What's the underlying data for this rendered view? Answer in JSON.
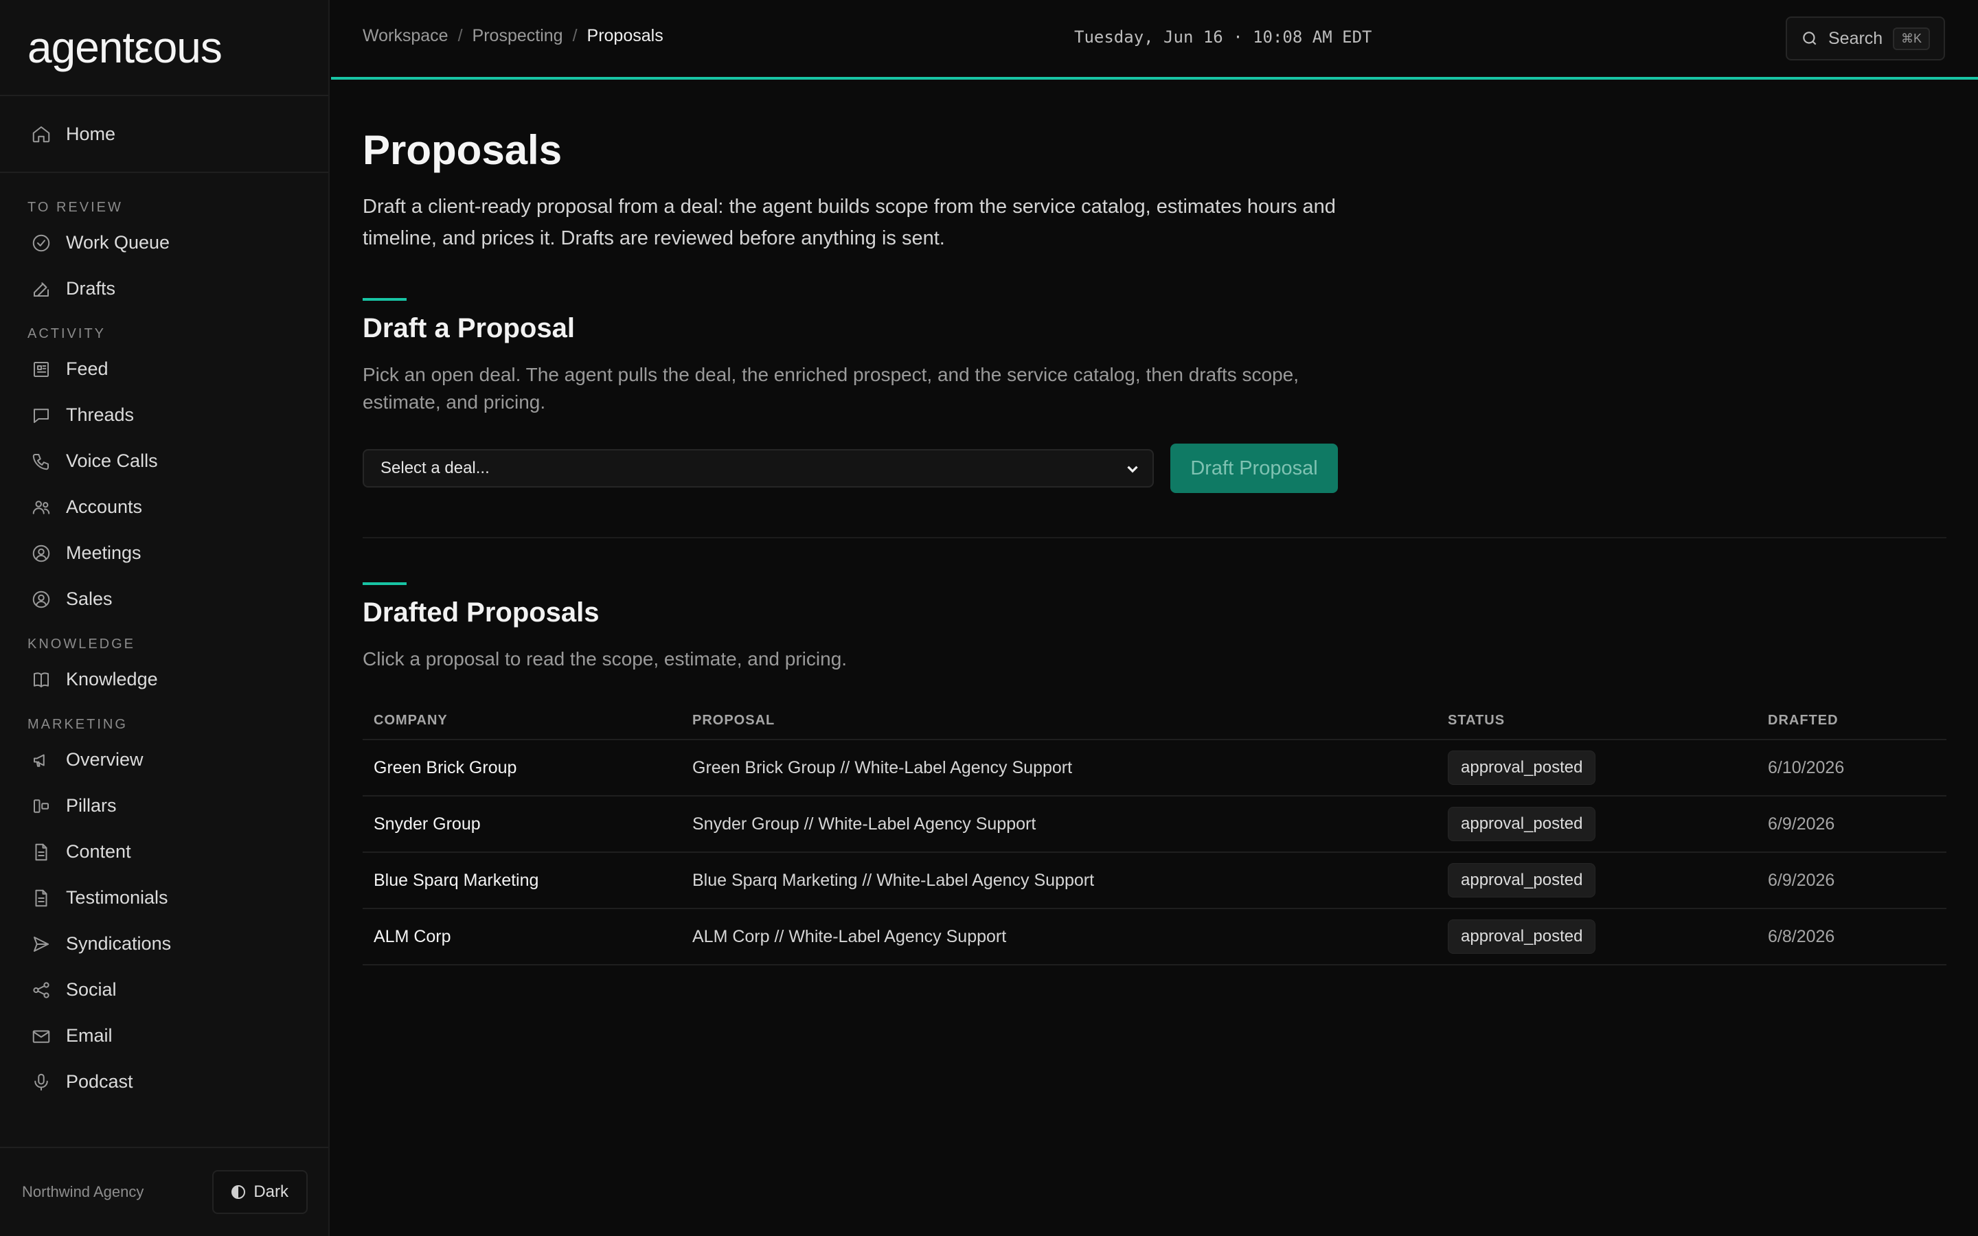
{
  "app": {
    "logo": "agentεous",
    "agency": "Northwind Agency",
    "theme_label": "Dark"
  },
  "header": {
    "breadcrumb": [
      "Workspace",
      "Prospecting",
      "Proposals"
    ],
    "datetime": "Tuesday, Jun 16 · 10:08 AM EDT",
    "search_label": "Search",
    "search_shortcut": "⌘K"
  },
  "sidebar": {
    "home": {
      "label": "Home",
      "icon": "home-icon"
    },
    "sections": [
      {
        "label": "TO REVIEW",
        "items": [
          {
            "label": "Work Queue",
            "icon": "check-circle-icon"
          },
          {
            "label": "Drafts",
            "icon": "edit-icon"
          }
        ]
      },
      {
        "label": "ACTIVITY",
        "items": [
          {
            "label": "Feed",
            "icon": "newspaper-icon"
          },
          {
            "label": "Threads",
            "icon": "chat-bubble-icon"
          },
          {
            "label": "Voice Calls",
            "icon": "phone-icon"
          },
          {
            "label": "Accounts",
            "icon": "users-icon"
          },
          {
            "label": "Meetings",
            "icon": "user-circle-icon"
          },
          {
            "label": "Sales",
            "icon": "user-circle-icon"
          }
        ]
      },
      {
        "label": "KNOWLEDGE",
        "items": [
          {
            "label": "Knowledge",
            "icon": "book-icon"
          }
        ]
      },
      {
        "label": "MARKETING",
        "items": [
          {
            "label": "Overview",
            "icon": "megaphone-icon"
          },
          {
            "label": "Pillars",
            "icon": "columns-icon"
          },
          {
            "label": "Content",
            "icon": "document-icon"
          },
          {
            "label": "Testimonials",
            "icon": "document-icon"
          },
          {
            "label": "Syndications",
            "icon": "send-icon"
          },
          {
            "label": "Social",
            "icon": "share-icon"
          },
          {
            "label": "Email",
            "icon": "mail-icon"
          },
          {
            "label": "Podcast",
            "icon": "microphone-icon"
          }
        ]
      }
    ]
  },
  "main": {
    "title": "Proposals",
    "description": "Draft a client-ready proposal from a deal: the agent builds scope from the service catalog, estimates hours and timeline, and prices it. Drafts are reviewed before anything is sent.",
    "draft_section": {
      "title": "Draft a Proposal",
      "subtitle": "Pick an open deal. The agent pulls the deal, the enriched prospect, and the service catalog, then drafts scope, estimate, and pricing.",
      "select_value": "Select a deal...",
      "button_label": "Draft Proposal"
    },
    "drafted_section": {
      "title": "Drafted Proposals",
      "subtitle": "Click a proposal to read the scope, estimate, and pricing.",
      "columns": [
        "COMPANY",
        "PROPOSAL",
        "STATUS",
        "DRAFTED"
      ],
      "rows": [
        {
          "company": "Green Brick Group",
          "proposal": "Green Brick Group // White-Label Agency Support",
          "status": "approval_posted",
          "drafted": "6/10/2026"
        },
        {
          "company": "Snyder Group",
          "proposal": "Snyder Group // White-Label Agency Support",
          "status": "approval_posted",
          "drafted": "6/9/2026"
        },
        {
          "company": "Blue Sparq Marketing",
          "proposal": "Blue Sparq Marketing // White-Label Agency Support",
          "status": "approval_posted",
          "drafted": "6/9/2026"
        },
        {
          "company": "ALM Corp",
          "proposal": "ALM Corp // White-Label Agency Support",
          "status": "approval_posted",
          "drafted": "6/8/2026"
        }
      ]
    }
  },
  "colors": {
    "accent": "#18c4a4",
    "button": "#0f7a64",
    "background": "#0b0b0b",
    "sidebar": "#111111"
  }
}
